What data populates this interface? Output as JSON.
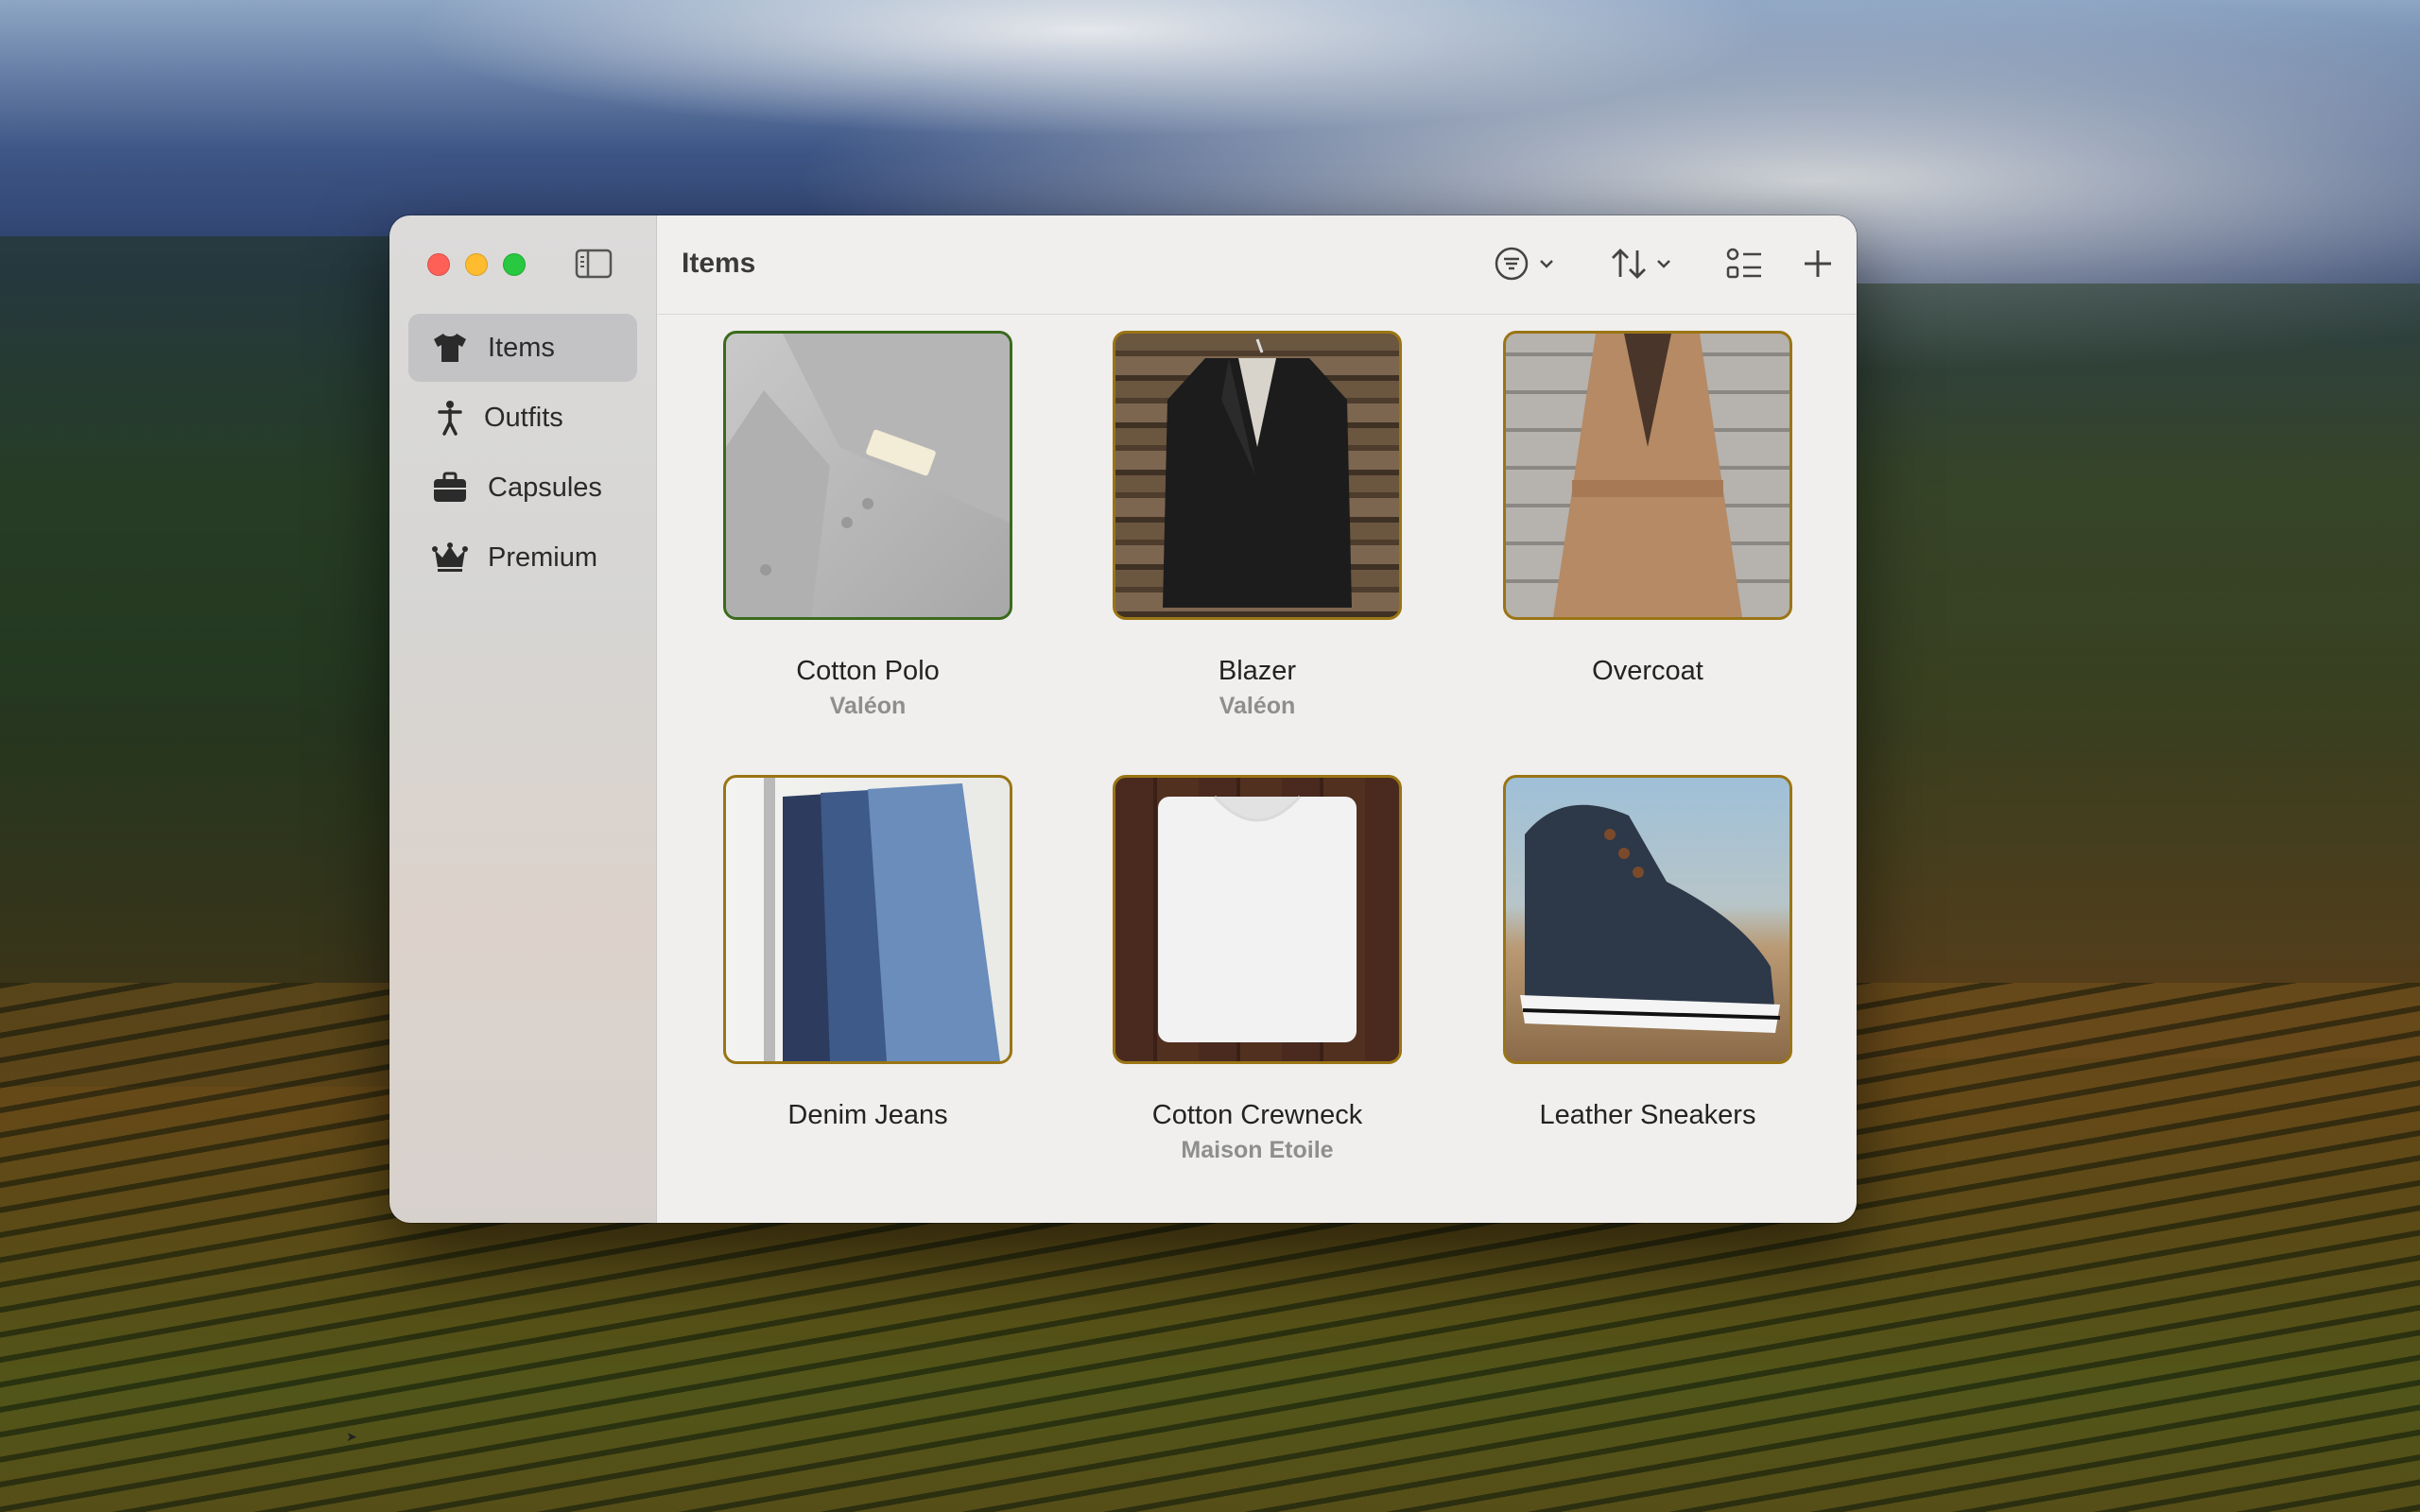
{
  "window": {
    "title": "Items"
  },
  "sidebar": {
    "items": [
      {
        "label": "Items",
        "icon": "tshirt-icon",
        "active": true
      },
      {
        "label": "Outfits",
        "icon": "person-icon",
        "active": false
      },
      {
        "label": "Capsules",
        "icon": "briefcase-icon",
        "active": false
      },
      {
        "label": "Premium",
        "icon": "crown-icon",
        "active": false
      }
    ]
  },
  "toolbar": {
    "filter_icon": "filter-icon",
    "sort_icon": "sort-icon",
    "list_icon": "list-icon",
    "add_icon": "plus-icon"
  },
  "items": [
    {
      "name": "Cotton Polo",
      "brand": "Valéon",
      "selected": true
    },
    {
      "name": "Blazer",
      "brand": "Valéon",
      "selected": false
    },
    {
      "name": "Overcoat",
      "brand": "",
      "selected": false
    },
    {
      "name": "Denim Jeans",
      "brand": "",
      "selected": false
    },
    {
      "name": "Cotton Crewneck",
      "brand": "Maison Etoile",
      "selected": false
    },
    {
      "name": "Leather Sneakers",
      "brand": "",
      "selected": false
    }
  ],
  "colors": {
    "selected_border": "#3b6a1c",
    "item_border": "#9a7514",
    "close": "#fe5f57",
    "minimize": "#febc2e",
    "zoom": "#28c840"
  }
}
